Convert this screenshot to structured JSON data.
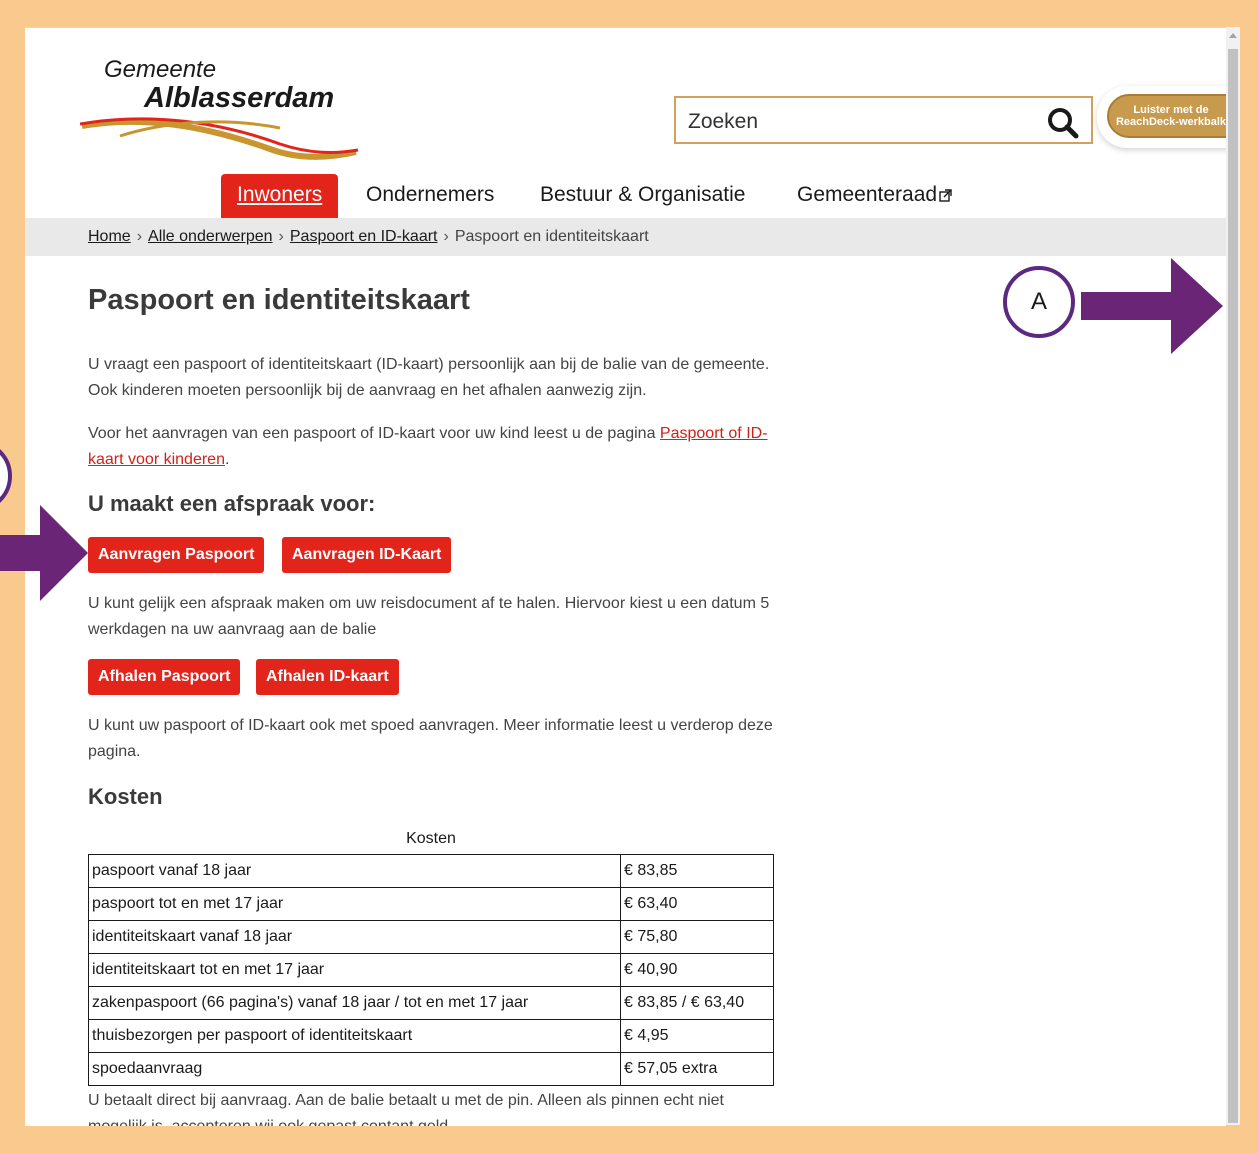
{
  "header": {
    "logo_top": "Gemeente",
    "logo_main": "Alblasserdam",
    "search_placeholder": "Zoeken",
    "reachdeck_label": "Luister met de ReachDeck-werkbalk"
  },
  "nav": {
    "items": [
      {
        "label": "Inwoners"
      },
      {
        "label": "Ondernemers"
      },
      {
        "label": "Bestuur & Organisatie"
      },
      {
        "label": "Gemeenteraad"
      }
    ]
  },
  "breadcrumb": {
    "items": [
      "Home",
      "Alle onderwerpen",
      "Paspoort en ID-kaart"
    ],
    "current": "Paspoort en identiteitskaart",
    "separator": "›"
  },
  "main": {
    "title": "Paspoort en identiteitskaart",
    "intro": "U vraagt een paspoort of identiteitskaart (ID-kaart) persoonlijk aan bij de balie van de gemeente. Ook kinderen moeten persoonlijk bij de aanvraag en het afhalen aanwezig zijn.",
    "child_text": "Voor het aanvragen van een paspoort of ID-kaart voor uw kind leest u de pagina ",
    "child_link": "Paspoort of ID-kaart voor kinderen",
    "child_end": ".",
    "appointment_heading": "U maakt een afspraak voor:",
    "apply_passport": "Aanvragen Paspoort",
    "apply_id": "Aanvragen ID-Kaart",
    "pickup_text": "U kunt gelijk een afspraak maken om uw reisdocument af te halen. Hiervoor kiest u een datum 5 werkdagen na uw aanvraag aan de balie",
    "pickup_passport": "Afhalen Paspoort",
    "pickup_id": "Afhalen ID-kaart",
    "urgent_text": "U kunt uw paspoort of ID-kaart ook met spoed aanvragen. Meer informatie leest u verderop deze pagina.",
    "costs_heading": "Kosten",
    "table_caption": "Kosten",
    "costs": [
      {
        "item": "paspoort vanaf 18 jaar",
        "price": "€ 83,85"
      },
      {
        "item": "paspoort tot en met 17 jaar",
        "price": "€ 63,40"
      },
      {
        "item": "identiteitskaart vanaf 18 jaar",
        "price": "€ 75,80"
      },
      {
        "item": "identiteitskaart tot en met 17 jaar",
        "price": "€ 40,90"
      },
      {
        "item": "zakenpaspoort (66 pagina's) vanaf 18 jaar / tot en met 17 jaar",
        "price": "€ 83,85 / € 63,40"
      },
      {
        "item": "thuisbezorgen per paspoort of identiteitskaart",
        "price": "€ 4,95"
      },
      {
        "item": "spoedaanvraag",
        "price": "€ 57,05 extra"
      }
    ],
    "payment_text": "U betaalt direct bij aanvraag. Aan de balie betaalt u met de pin. Alleen als pinnen echt niet mogelijk is, accepteren wij ook gepast contant geld."
  },
  "annotations": {
    "marker_a": "A",
    "arrow_color": "#6b2577",
    "circle_color": "#5b2a80"
  },
  "colors": {
    "brand_red": "#e3241b",
    "frame": "#f9c98e",
    "search_border": "#d4a15c",
    "reachdeck": "#c89a4e"
  }
}
